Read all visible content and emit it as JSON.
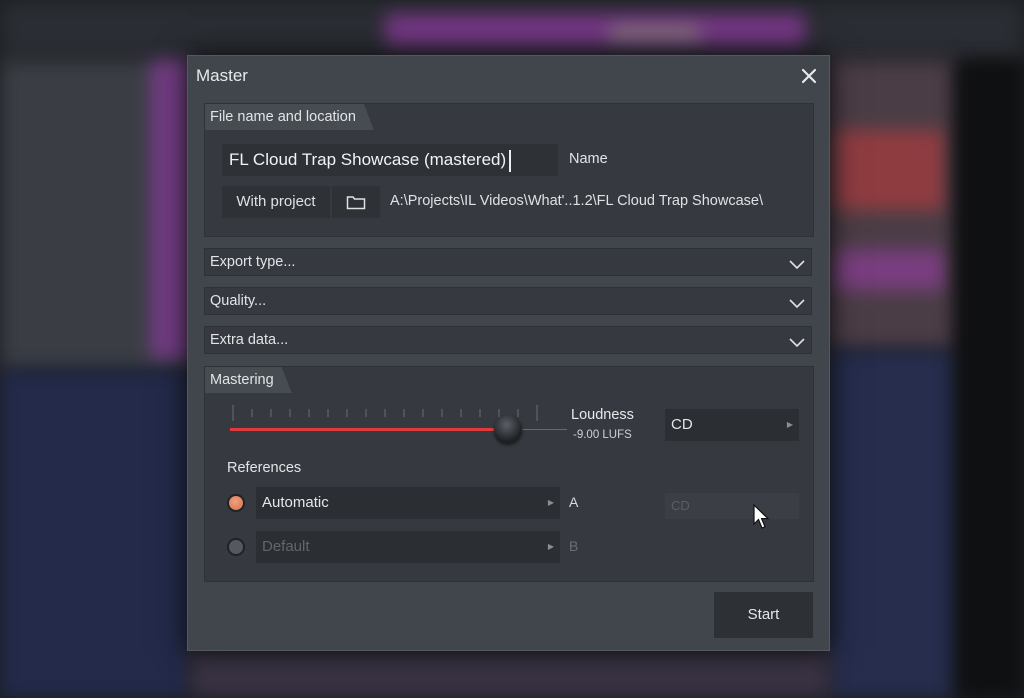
{
  "dialog": {
    "title": "Master"
  },
  "file_section": {
    "title": "File name and location",
    "file_name_value": "FL Cloud Trap Showcase (mastered)",
    "name_label": "Name",
    "location_mode": "With project",
    "path": "A:\\Projects\\IL Videos\\What'..1.2\\FL Cloud Trap Showcase\\"
  },
  "sections": {
    "export_type": "Export type...",
    "quality": "Quality...",
    "extra_data": "Extra data..."
  },
  "mastering": {
    "title": "Mastering",
    "loudness_label": "Loudness",
    "loudness_value": "-9.00 LUFS",
    "loudness_level": 0.9,
    "target_select": "CD",
    "disabled_select": "CD",
    "references_title": "References",
    "reference_a": {
      "value": "Automatic",
      "label": "A",
      "selected": true
    },
    "reference_b": {
      "value": "Default",
      "label": "B",
      "selected": false
    }
  },
  "start_label": "Start",
  "colors": {
    "accent": "#e03a3a",
    "radio_active": "#e08a66"
  }
}
